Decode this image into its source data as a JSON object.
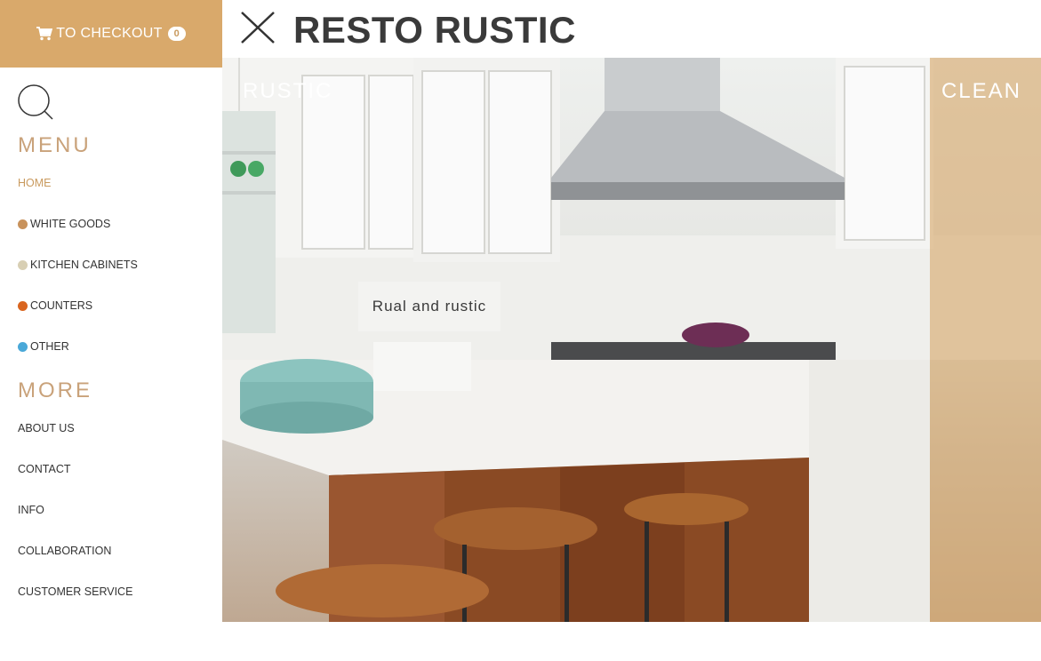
{
  "checkout": {
    "label": "TO CHECKOUT",
    "count": "0",
    "icon": "cart-icon"
  },
  "search": {
    "icon": "search-icon"
  },
  "header": {
    "title": "RESTO RUSTIC",
    "close_icon": "close-icon"
  },
  "menu": {
    "title": "MENU",
    "items": [
      {
        "label": "HOME",
        "color": ""
      },
      {
        "label": "WHITE GOODS",
        "color": "#c8925c"
      },
      {
        "label": "KITCHEN CABINETS",
        "color": "#d8cfb4"
      },
      {
        "label": "COUNTERS",
        "color": "#d9651f"
      },
      {
        "label": "OTHER",
        "color": "#4aa8d8"
      }
    ]
  },
  "more": {
    "title": "MORE",
    "items": [
      {
        "label": "ABOUT US"
      },
      {
        "label": "CONTACT"
      },
      {
        "label": "INFO"
      },
      {
        "label": "COLLABORATION"
      },
      {
        "label": "CUSTOMER SERVICE"
      }
    ]
  },
  "hero": {
    "left_label": "RUSTIC",
    "right_label": "CLEAN",
    "caption": "Rual and rustic"
  },
  "colors": {
    "accent": "#d9a96b",
    "accent_text": "#c9a27a",
    "overlay": "#d6a86a"
  }
}
